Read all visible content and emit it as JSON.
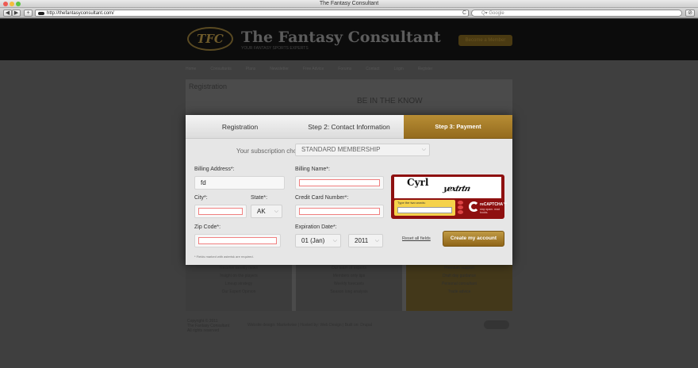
{
  "window": {
    "title": "The Fantasy Consultant",
    "traffic_colors": [
      "#ee5b54",
      "#f5bd3b",
      "#5cc443"
    ]
  },
  "toolbar": {
    "back_icon": "back-arrow-icon",
    "forward_icon": "forward-arrow-icon",
    "add_label": "+",
    "url": "http://thefantasyconsultant.com/",
    "reload_glyph": "C",
    "search_placeholder": "Q▾ Google",
    "right_button_glyph": "⊘"
  },
  "site": {
    "logo_text": "TFC",
    "title": "The Fantasy Consultant",
    "tagline": "YOUR FANTASY SPORTS EXPERTS",
    "header_button": "Become a Member",
    "nav": [
      "Home",
      "Consultants",
      "Plans",
      "Newsletter",
      "Free Advice",
      "Forums",
      "Contact",
      "Login",
      "Register"
    ],
    "section_title": "Registration",
    "promo_heading": "BE IN THE KNOW",
    "col1": [
      "Receive weekly news",
      "Insight on the players",
      "Lineup strategy",
      "Our Expert Opinion"
    ],
    "col2": [
      "Our team of experts",
      "Members only tips",
      "Weekly forecasts",
      "Season long analysis"
    ],
    "col3": [
      "Premium support",
      "Draft day guidance",
      "Personal consultant",
      "Trade advice"
    ],
    "footer_left": [
      "Copyright © 2011",
      "The Fantasy Consultant",
      "All rights reserved"
    ],
    "footer_mid": "Website design: Marketwise  |  Hosted by: Web Design  |  Built on: Drupal",
    "colors": {
      "accent": "#a57a28",
      "modal_bg": "#e6e6e6",
      "error": "#f08080"
    }
  },
  "modal": {
    "tabs": [
      {
        "label": "Registration",
        "active": false
      },
      {
        "label": "Step 2: Contact Information",
        "active": false
      },
      {
        "label": "Step 3: Payment",
        "active": true
      }
    ],
    "subscription_label": "Your subscription choice is:",
    "subscription_value": "STANDARD MEMBERSHIP",
    "billing_address_label": "Billing Address*:",
    "billing_address_value": "fd",
    "billing_name_label": "Billing Name*:",
    "billing_name_value": "",
    "city_label": "City*:",
    "city_value": "",
    "state_label": "State*:",
    "state_value": "AK",
    "card_label": "Credit Card Number*:",
    "card_value": "",
    "zip_label": "Zip Code*:",
    "zip_value": "",
    "exp_label": "Expiration Date*:",
    "exp_month": "01 (Jan)",
    "exp_year": "2011",
    "captcha": {
      "word1": "Cyrl",
      "word2": "yextrtn",
      "input_label": "Type the two words:",
      "brand": "reCAPTCHA™",
      "sub": "stop spam. read books."
    },
    "reset_label": "Reset all fields",
    "submit_label": "Create my account",
    "required_note": "* Fields marked with asterisk are required."
  }
}
